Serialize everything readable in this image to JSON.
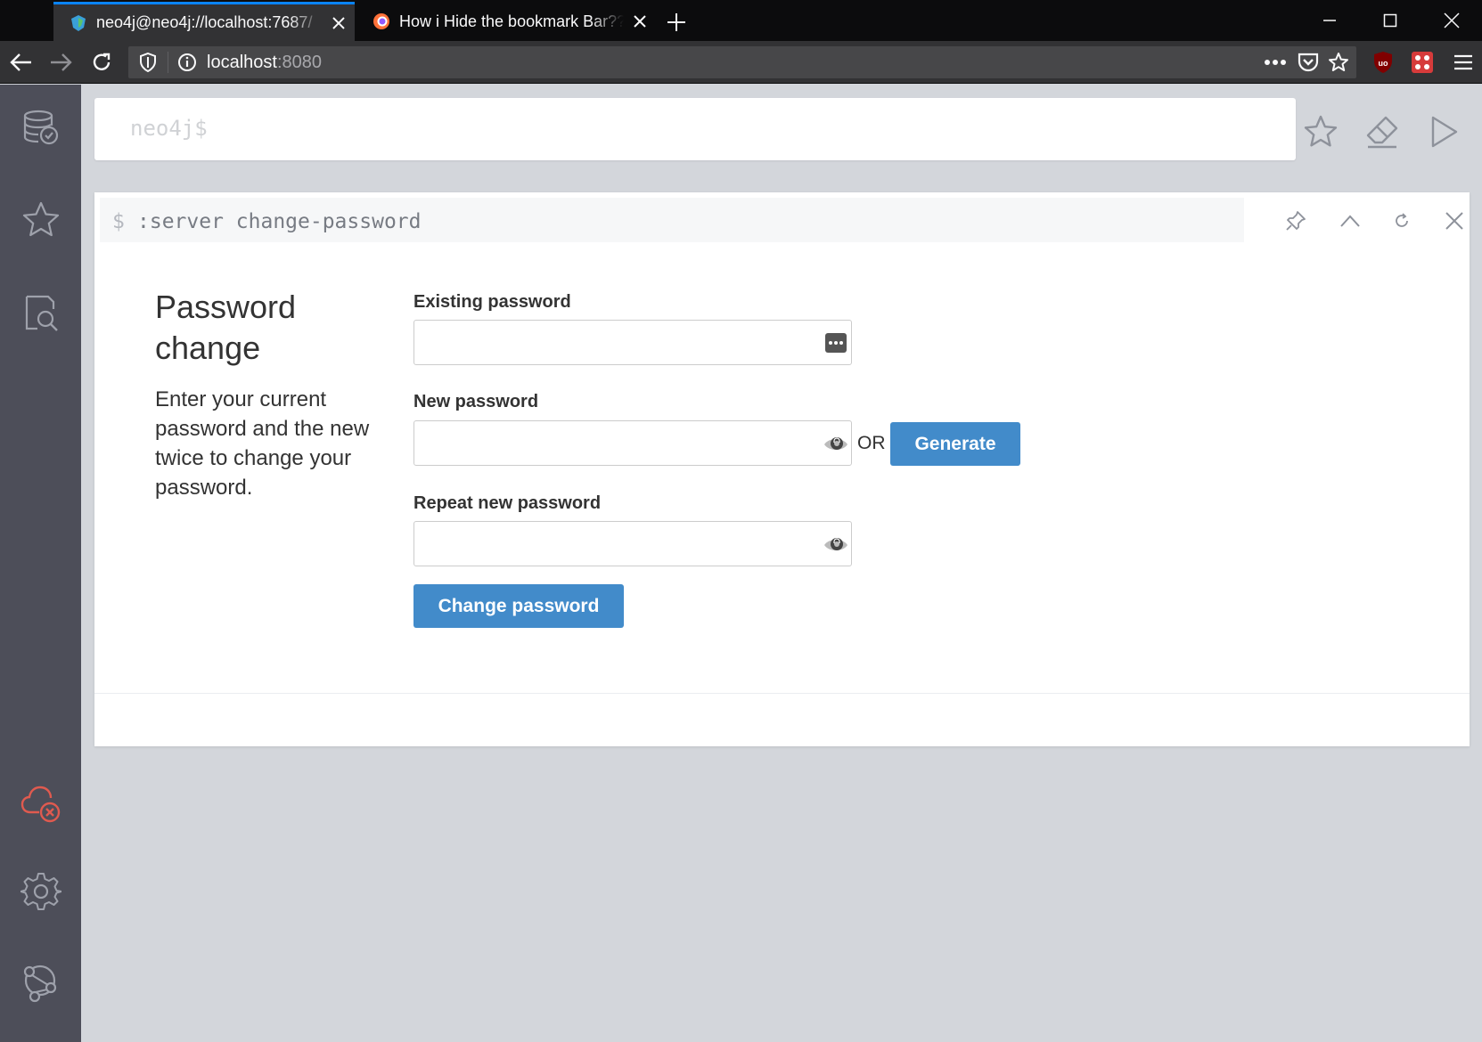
{
  "browser": {
    "tabs": [
      {
        "title": "neo4j@neo4j://localhost:7687/",
        "active": true,
        "favicon": "neo4j-icon"
      },
      {
        "title": "How i Hide the bookmark Bar?? :",
        "active": false,
        "favicon": "firefox-icon"
      }
    ],
    "url": {
      "host": "localhost",
      "port": ":8080"
    }
  },
  "sidebar": {
    "items": [
      {
        "name": "database-icon"
      },
      {
        "name": "favorites-icon"
      },
      {
        "name": "documents-search-icon"
      },
      {
        "name": "connection-error-icon",
        "color": "#e05a4f"
      },
      {
        "name": "settings-icon"
      },
      {
        "name": "neo4j-about-icon"
      }
    ]
  },
  "editor": {
    "prompt": "neo4j$"
  },
  "frame": {
    "dollar": "$",
    "command": ":server change-password",
    "title": "Password change",
    "description": "Enter your current password and the new twice to change your password.",
    "fields": {
      "existing_label": "Existing password",
      "new_label": "New password",
      "repeat_label": "Repeat new password"
    },
    "or_text": "OR",
    "generate_label": "Generate",
    "submit_label": "Change password"
  },
  "colors": {
    "primary_button": "#428bca",
    "sidebar": "#4d4e59",
    "background": "#d3d6db",
    "active_tab_accent": "#0a84ff"
  }
}
